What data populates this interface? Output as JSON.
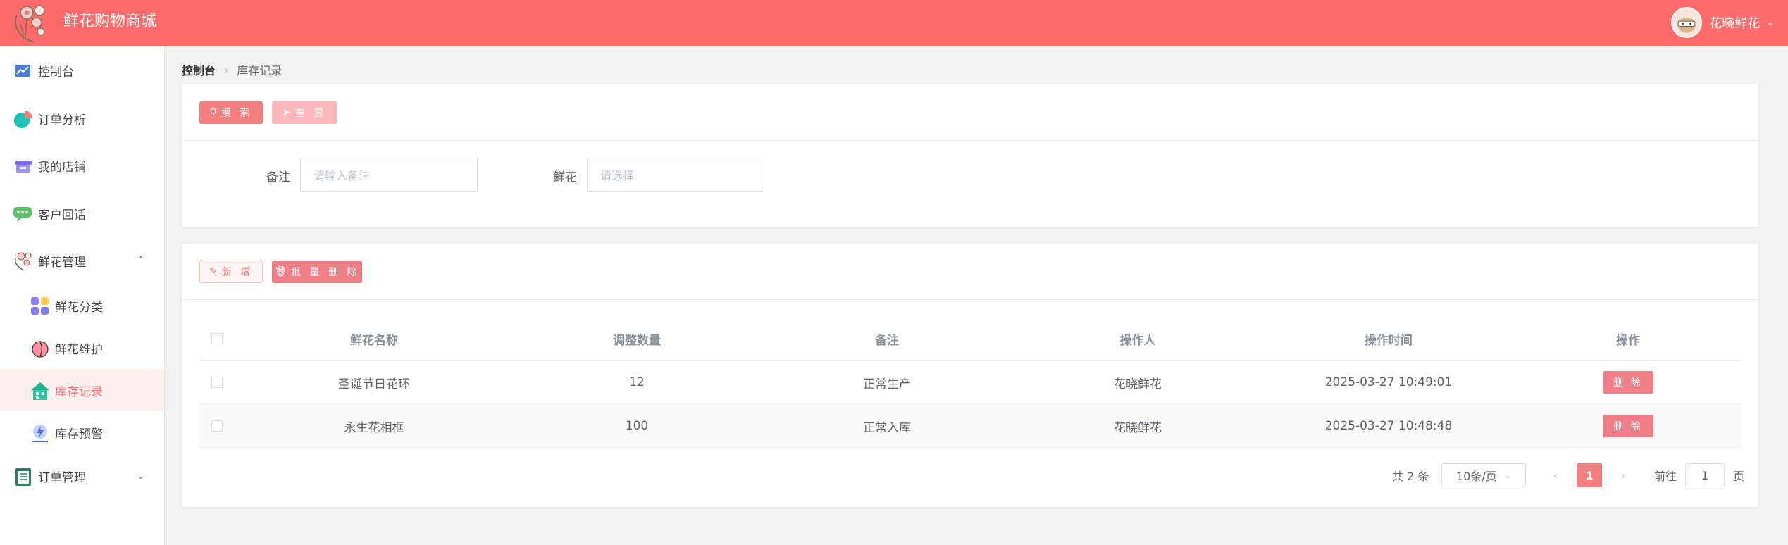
{
  "header": {
    "title": "鲜花购物商城",
    "user_name": "花晓鲜花"
  },
  "sidebar": {
    "items": [
      {
        "label": "控制台",
        "icon": "chart-icon"
      },
      {
        "label": "订单分析",
        "icon": "pie-icon"
      },
      {
        "label": "我的店铺",
        "icon": "store-icon"
      },
      {
        "label": "客户回话",
        "icon": "chat-icon"
      },
      {
        "label": "鲜花管理",
        "icon": "flower-icon",
        "expanded": true
      },
      {
        "label": "鲜花分类",
        "icon": "category-icon"
      },
      {
        "label": "鲜花维护",
        "icon": "peach-icon"
      },
      {
        "label": "库存记录",
        "icon": "house-icon",
        "active": true
      },
      {
        "label": "库存预警",
        "icon": "alert-icon"
      },
      {
        "label": "订单管理",
        "icon": "clipboard-icon",
        "expanded": false
      }
    ]
  },
  "breadcrumb": {
    "home": "控制台",
    "current": "库存记录"
  },
  "search_form": {
    "search_label": "搜 索",
    "reset_label": "重 置",
    "fields": [
      {
        "label": "备注",
        "placeholder": "请输入备注"
      },
      {
        "label": "鲜花",
        "placeholder": "请选择"
      }
    ]
  },
  "toolbar": {
    "add_label": "新 增",
    "batch_delete_label": "批 量 删 除"
  },
  "table": {
    "columns": [
      "鲜花名称",
      "调整数量",
      "备注",
      "操作人",
      "操作时间",
      "操作"
    ],
    "rows": [
      {
        "name": "圣诞节日花环",
        "qty": "12",
        "note": "正常生产",
        "operator": "花晓鲜花",
        "time": "2025-03-27 10:49:01",
        "action": "删 除"
      },
      {
        "name": "永生花相框",
        "qty": "100",
        "note": "正常入库",
        "operator": "花晓鲜花",
        "time": "2025-03-27 10:48:48",
        "action": "删 除"
      }
    ]
  },
  "pagination": {
    "total_text": "共 2 条",
    "page_size": "10条/页",
    "current_page": "1",
    "goto_prefix": "前往",
    "goto_value": "1",
    "goto_suffix": "页"
  },
  "colors": {
    "brand": "#ff6b6b",
    "accent": "#f27e80"
  }
}
